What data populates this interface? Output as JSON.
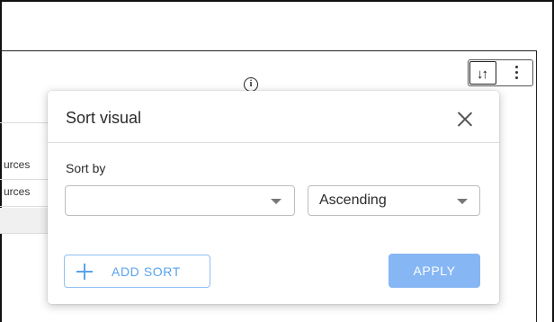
{
  "toolbar": {
    "sort_icon": "sort-arrows-icon",
    "more_icon": "more-vertical-icon",
    "sort_glyph": "↓↑"
  },
  "info": {
    "glyph": "i"
  },
  "background": {
    "rows": [
      "urces",
      "urces"
    ]
  },
  "dialog": {
    "title": "Sort visual",
    "sort_by_label": "Sort by",
    "field_select": {
      "value": ""
    },
    "order_select": {
      "value": "Ascending"
    },
    "add_sort_label": "ADD SORT",
    "apply_label": "APPLY"
  },
  "colors": {
    "accent": "#5aa3ee",
    "apply_bg": "#86b6f4"
  }
}
